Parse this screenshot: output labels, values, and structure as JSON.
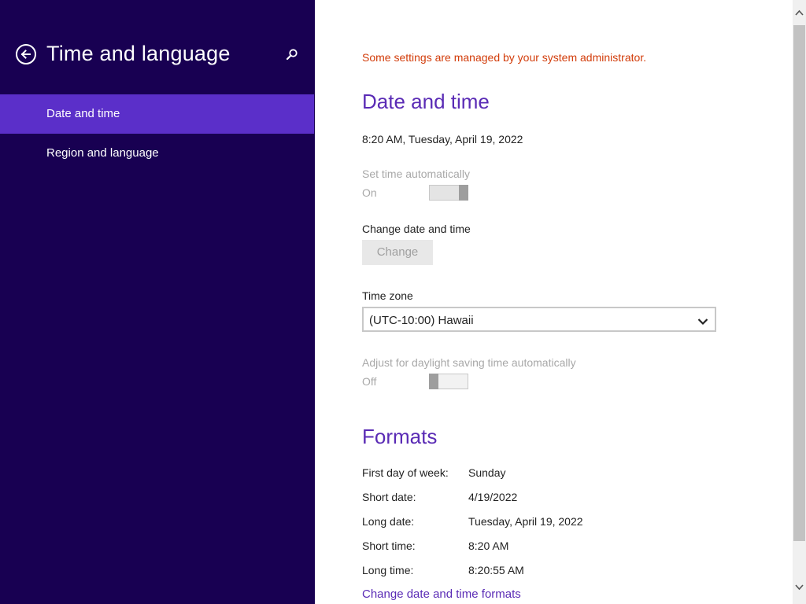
{
  "left_pane": {
    "title": "Time and language",
    "back_icon": "back-arrow-icon",
    "search_icon": "search-icon",
    "nav_items": [
      {
        "label": "Date and time",
        "selected": true
      },
      {
        "label": "Region and language",
        "selected": false
      }
    ]
  },
  "content": {
    "admin_note": "Some settings are managed by your system administrator.",
    "date_time_section": {
      "heading": "Date and time",
      "current_datetime": "8:20 AM, Tuesday, April 19, 2022",
      "set_time_auto_label": "Set time automatically",
      "set_time_auto_state": "On",
      "change_label": "Change date and time",
      "change_button": "Change",
      "time_zone_label": "Time zone",
      "time_zone_value": "(UTC-10:00) Hawaii",
      "dst_label": "Adjust for daylight saving time automatically",
      "dst_state": "Off"
    },
    "formats_section": {
      "heading": "Formats",
      "rows": [
        {
          "label": "First day of week:",
          "value": "Sunday"
        },
        {
          "label": "Short date:",
          "value": "4/19/2022"
        },
        {
          "label": "Long date:",
          "value": "Tuesday, April 19, 2022"
        },
        {
          "label": "Short time:",
          "value": "8:20 AM"
        },
        {
          "label": "Long time:",
          "value": "8:20:55 AM"
        }
      ],
      "link": "Change date and time formats"
    }
  },
  "colors": {
    "left_pane_bg": "#180052",
    "selected_item_bg": "#5b2fc9",
    "accent_heading": "#5a2bb5",
    "admin_note": "#d23c0a"
  }
}
